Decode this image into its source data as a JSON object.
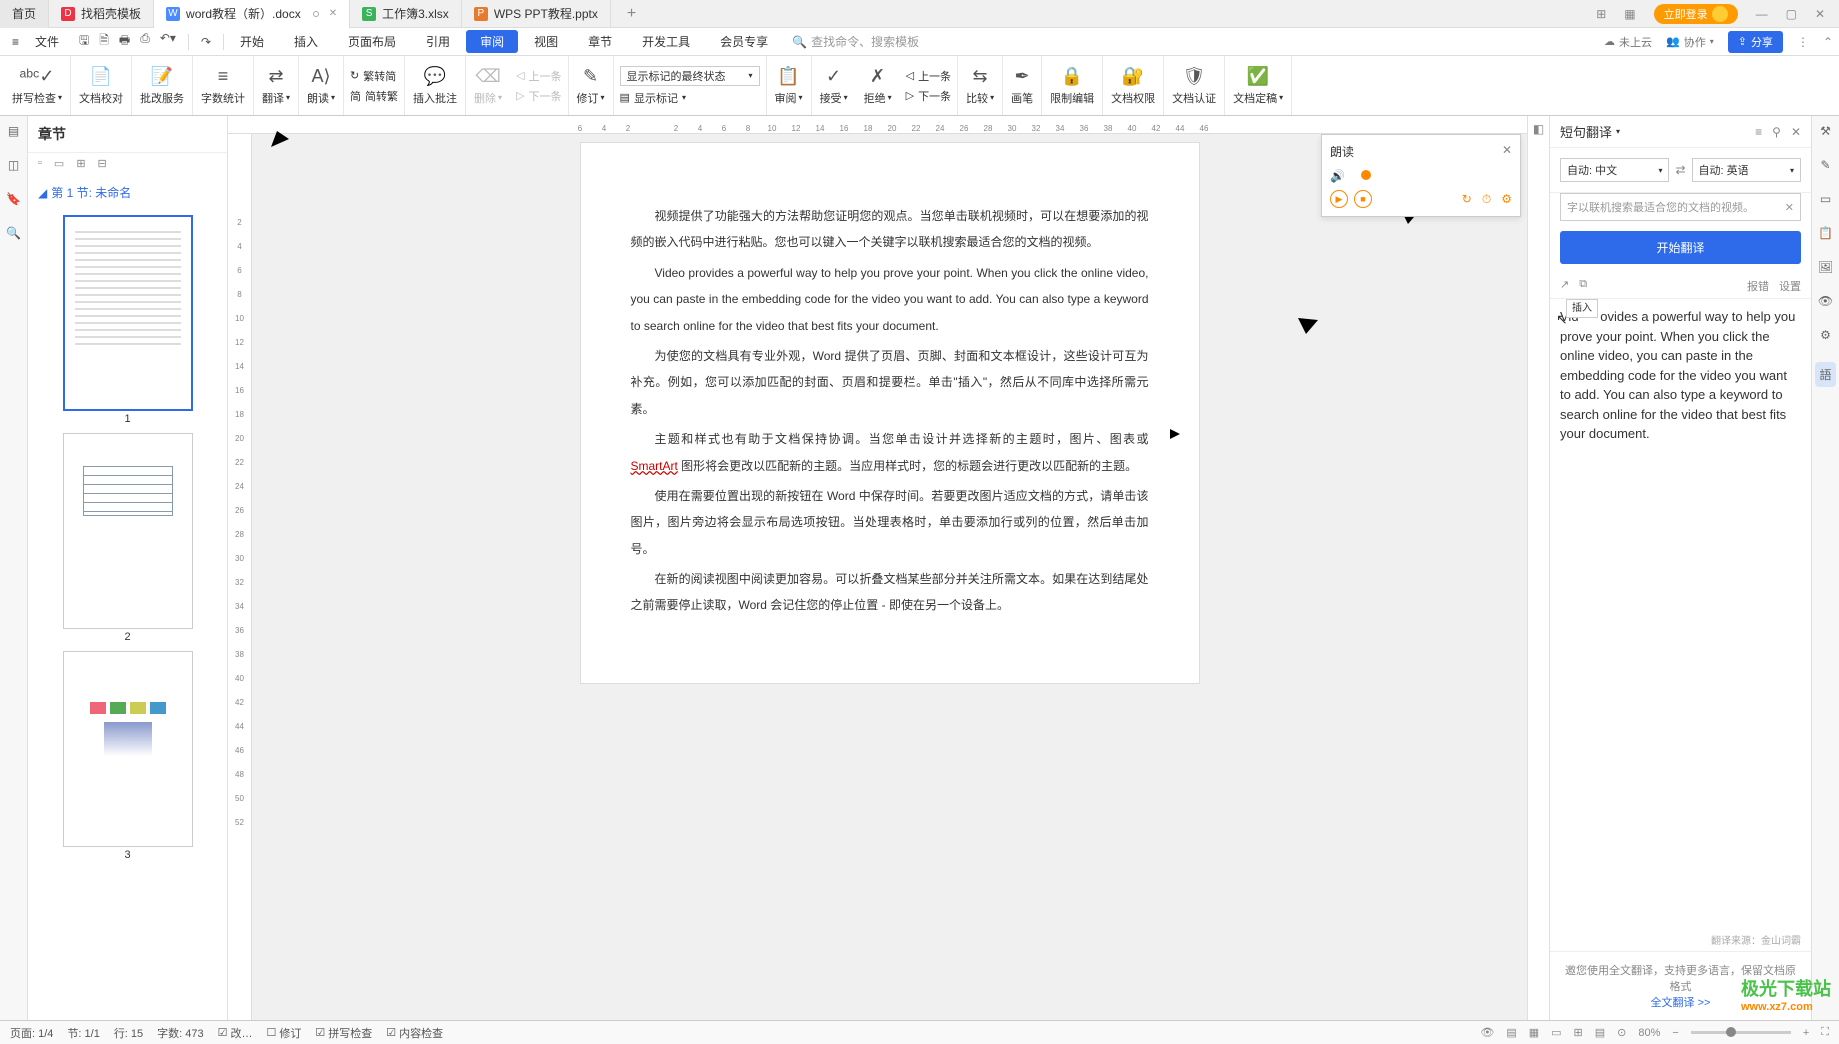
{
  "tabs": {
    "home": "首页",
    "t1": "找稻壳模板",
    "t2": "word教程（新）.docx",
    "t3": "工作簿3.xlsx",
    "t4": "WPS PPT教程.pptx"
  },
  "login_btn": "立即登录",
  "file_menu": "文件",
  "search_placeholder": "查找命令、搜索模板",
  "cloud_text": "未上云",
  "collab_text": "协作",
  "share_text": "分享",
  "menus": [
    "开始",
    "插入",
    "页面布局",
    "引用",
    "审阅",
    "视图",
    "章节",
    "开发工具",
    "会员专享"
  ],
  "ribbon": {
    "spellcheck": "拼写检查",
    "doc_proof": "文档校对",
    "approve": "批改服务",
    "wordcount": "字数统计",
    "translate": "翻译",
    "read": "朗读",
    "simp2trad": "繁转简",
    "trad2simp": "简转繁",
    "insert_comment": "插入批注",
    "delete": "删除",
    "prev": "上一条",
    "next": "下一条",
    "revise": "修订",
    "show_mark_state": "显示标记的最终状态",
    "show_mark": "显示标记",
    "review": "审阅",
    "accept": "接受",
    "reject": "拒绝",
    "prev2": "上一条",
    "next2": "下一条",
    "compare": "比较",
    "ink": "画笔",
    "restrict": "限制编辑",
    "doc_perm": "文档权限",
    "doc_auth": "文档认证",
    "doc_finalize": "文档定稿"
  },
  "chapter": {
    "title": "章节",
    "item1": "第 1 节: 未命名",
    "thumbs": [
      "1",
      "2",
      "3"
    ]
  },
  "ruler_top": [
    "6",
    "4",
    "2",
    "",
    "2",
    "4",
    "6",
    "8",
    "10",
    "12",
    "14",
    "16",
    "18",
    "20",
    "22",
    "24",
    "26",
    "28",
    "30",
    "32",
    "34",
    "36",
    "38",
    "40",
    "42",
    "44",
    "46"
  ],
  "ruler_left": [
    "",
    "2",
    "4",
    "6",
    "8",
    "10",
    "12",
    "14",
    "16",
    "18",
    "20",
    "22",
    "24",
    "26",
    "28",
    "30",
    "32",
    "34",
    "36",
    "38",
    "40",
    "42",
    "44",
    "46",
    "48",
    "50",
    "52"
  ],
  "doc": {
    "p1": "视频提供了功能强大的方法帮助您证明您的观点。当您单击联机视频时，可以在想要添加的视频的嵌入代码中进行粘贴。您也可以键入一个关键字以联机搜索最适合您的文档的视频。",
    "p2": "Video provides a powerful way to help you prove your point. When you click the online video, you can paste in the embedding code for the video you want to add. You can also type a keyword to search online for the video that best fits your document.",
    "p3a": "为使您的文档具有专业外观，Word 提供了页眉、页脚、封面和文本框设计，这些设计可互为补充。例如，您可以添加匹配的封面、页眉和提要栏。单击\"插入\"，然后从不同库中选择所需元素。",
    "p4a": "主题和样式也有助于文档保持协调。当您单击设计并选择新的主题时，图片、图表或 ",
    "smartart": "SmartArt",
    "p4b": " 图形将会更改以匹配新的主题。当应用样式时，您的标题会进行更改以匹配新的主题。",
    "p5": "使用在需要位置出现的新按钮在 Word 中保存时间。若要更改图片适应文档的方式，请单击该图片，图片旁边将会显示布局选项按钮。当处理表格时，单击要添加行或列的位置，然后单击加号。",
    "p6": "在新的阅读视图中阅读更加容易。可以折叠文档某些部分并关注所需文本。如果在达到结尾处之前需要停止读取，Word 会记住您的停止位置 - 即使在另一个设备上。"
  },
  "read_popup": {
    "title": "朗读"
  },
  "trans": {
    "title": "短句翻译",
    "from_lang": "自动: 中文",
    "to_lang": "自动: 英语",
    "src_text": "字以联机搜索最适合您的文档的视频。",
    "btn": "开始翻译",
    "report": "报错",
    "settings": "设置",
    "insert_tip": "插入",
    "result_a": "Vid",
    "result_b": "ovides a powerful way to help you prove your point. When you click the online video, you can paste in the embedding code for the video you want to add. You can also type a keyword to search online for the video that best fits your document.",
    "source": "翻译来源：金山词霸",
    "foot1": "邀您使用全文翻译，支持更多语言，保留文档原格式",
    "foot_link": "全文翻译 >>"
  },
  "status": {
    "page": "页面: 1/4",
    "section": "节: 1/1",
    "row": "行: 15",
    "words": "字数: 473",
    "insert": "改…",
    "revise": "修订",
    "spell": "拼写检查",
    "content": "内容检查",
    "zoom": "80%"
  },
  "watermark": {
    "line1": "极光下载站",
    "line2": "www.xz7.com"
  }
}
